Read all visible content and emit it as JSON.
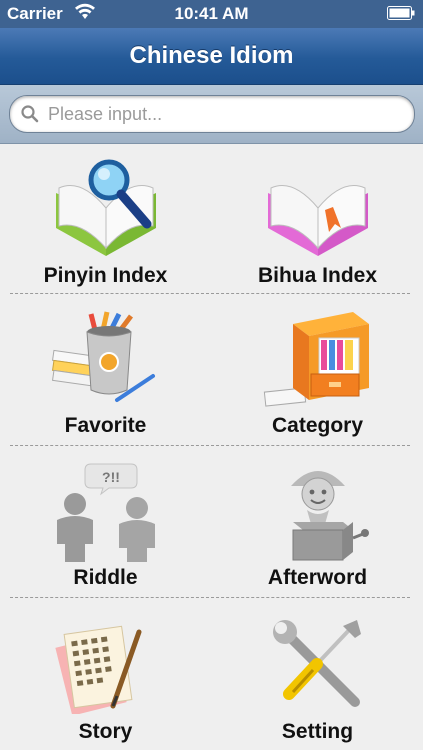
{
  "status": {
    "carrier": "Carrier",
    "time": "10:41 AM"
  },
  "nav": {
    "title": "Chinese Idiom"
  },
  "search": {
    "placeholder": "Please input..."
  },
  "menu": [
    {
      "label": "Pinyin Index",
      "icon": "open-book-magnifier-icon"
    },
    {
      "label": "Bihua Index",
      "icon": "open-book-bookmark-icon"
    },
    {
      "label": "Favorite",
      "icon": "pencil-cup-icon"
    },
    {
      "label": "Category",
      "icon": "file-cabinet-icon"
    },
    {
      "label": "Riddle",
      "icon": "people-question-icon"
    },
    {
      "label": "Afterword",
      "icon": "jack-in-the-box-icon"
    },
    {
      "label": "Story",
      "icon": "paper-pen-icon"
    },
    {
      "label": "Setting",
      "icon": "wrench-screwdriver-icon"
    }
  ]
}
